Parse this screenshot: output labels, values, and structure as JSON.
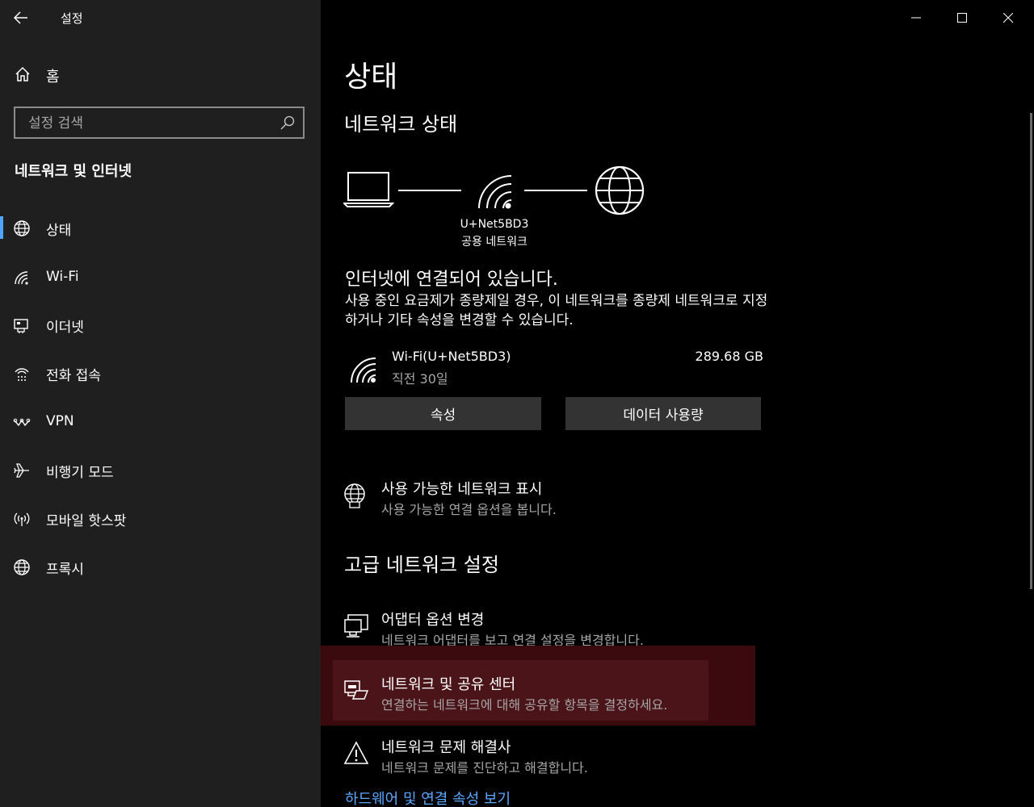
{
  "window": {
    "app_title": "설정"
  },
  "sidebar": {
    "home_label": "홈",
    "search_placeholder": "설정 검색",
    "section_title": "네트워크 및 인터넷",
    "items": [
      {
        "label": "상태",
        "icon": "status-globe-icon"
      },
      {
        "label": "Wi-Fi",
        "icon": "wifi-icon"
      },
      {
        "label": "이더넷",
        "icon": "ethernet-icon"
      },
      {
        "label": "전화 접속",
        "icon": "dialup-icon"
      },
      {
        "label": "VPN",
        "icon": "vpn-icon"
      },
      {
        "label": "비행기 모드",
        "icon": "airplane-icon"
      },
      {
        "label": "모바일 핫스팟",
        "icon": "hotspot-icon"
      },
      {
        "label": "프록시",
        "icon": "globe-icon"
      }
    ],
    "active_index": 0,
    "accent_color": "#4ea6ff"
  },
  "main": {
    "page_title": "상태",
    "network_status_heading": "네트워크 상태",
    "network": {
      "ssid": "U+Net5BD3",
      "type": "공용 네트워크"
    },
    "connected_text": "인터넷에 연결되어 있습니다.",
    "metered_desc": "사용 중인 요금제가 종량제일 경우, 이 네트워크를 종량제 네트워크로 지정하거나 기타 속성을 변경할 수 있습니다.",
    "connection": {
      "name": "Wi-Fi(U+Net5BD3)",
      "last_period": "직전 30일",
      "usage": "289.68 GB"
    },
    "properties_button": "속성",
    "data_usage_button": "데이터 사용량",
    "show_networks": {
      "title": "사용 가능한 네트워크 표시",
      "desc": "사용 가능한 연결 옵션을 봅니다."
    },
    "advanced_heading": "고급 네트워크 설정",
    "adapter": {
      "title": "어댑터 옵션 변경",
      "desc": "네트워크 어댑터를 보고 연결 설정을 변경합니다."
    },
    "sharing_center": {
      "title": "네트워크 및 공유 센터",
      "desc": "연결하는 네트워크에 대해 공유할 항목을 결정하세요."
    },
    "troubleshooter": {
      "title": "네트워크 문제 해결사",
      "desc": "네트워크 문제를 진단하고 해결합니다."
    },
    "hw_link": "하드웨어 및 연결 속성 보기",
    "link_color": "#5aa8ff"
  }
}
